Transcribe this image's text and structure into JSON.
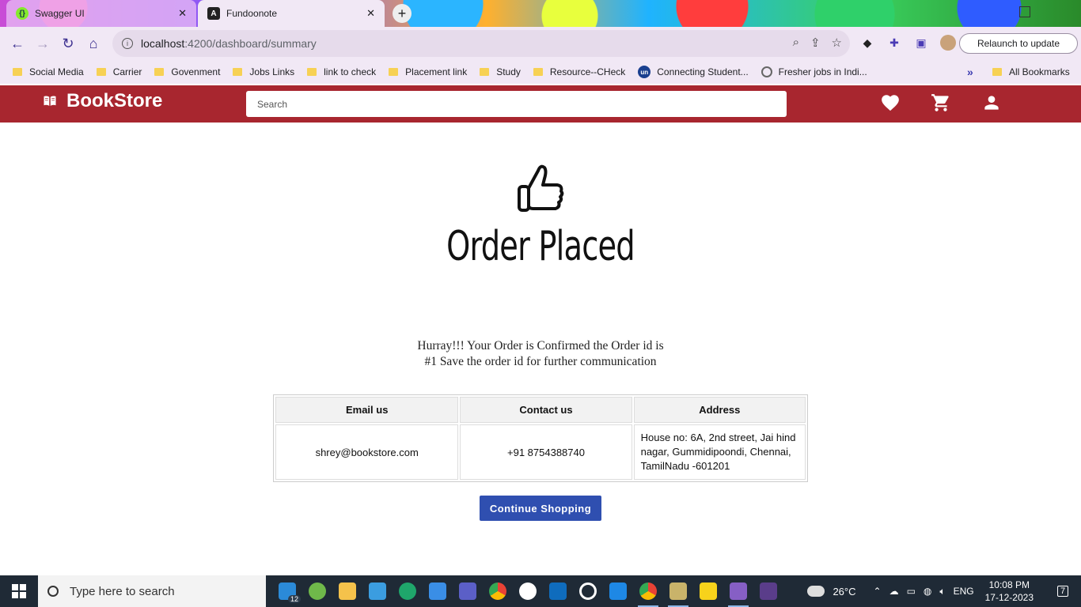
{
  "browser": {
    "tabs": [
      {
        "title": "Swagger UI",
        "active": false
      },
      {
        "title": "Fundoonote",
        "active": true
      }
    ],
    "new_tab": "+",
    "url_host": "localhost",
    "url_path": ":4200/dashboard/summary",
    "relaunch_label": "Relaunch to update",
    "bookmarks": [
      {
        "label": "Social Media",
        "icon": "folder-icon"
      },
      {
        "label": "Carrier",
        "icon": "folder-icon"
      },
      {
        "label": "Govenment",
        "icon": "folder-icon"
      },
      {
        "label": "Jobs Links",
        "icon": "folder-icon"
      },
      {
        "label": "link to check",
        "icon": "folder-icon"
      },
      {
        "label": "Placement link",
        "icon": "folder-icon"
      },
      {
        "label": "Study",
        "icon": "folder-icon"
      },
      {
        "label": "Resource--CHeck",
        "icon": "folder-icon"
      },
      {
        "label": "Connecting Student...",
        "icon": "un-logo-icon"
      },
      {
        "label": "Fresher jobs in Indi...",
        "icon": "globe-icon"
      }
    ],
    "bookmarks_more": "»",
    "all_bookmarks": "All Bookmarks"
  },
  "app": {
    "brand": "BookStore",
    "search_placeholder": "Search",
    "header_color": "#a8262f"
  },
  "order": {
    "title": "Order Placed",
    "message": "Hurray!!! Your Order is Confirmed the Order id is #1 Save the order id for further communication",
    "table": {
      "headers": [
        "Email us",
        "Contact us",
        "Address"
      ],
      "email": "shrey@bookstore.com",
      "phone": "+91 8754388740",
      "address": "House no: 6A, 2nd street, Jai hind nagar, Gummidipoondi, Chennai, TamilNadu -601201"
    },
    "continue_label": "Continue Shopping",
    "button_color": "#2f4fb0"
  },
  "taskbar": {
    "search_placeholder": "Type here to search",
    "vscode_badge": "12",
    "weather_temp": "26°C",
    "language": "ENG",
    "time": "10:08 PM",
    "date": "17-12-2023",
    "notification_count": "7"
  }
}
